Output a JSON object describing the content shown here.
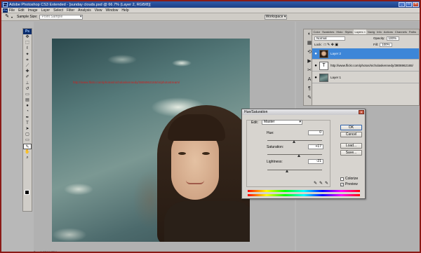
{
  "window": {
    "title": "Adobe Photoshop CS3 Extended - [sunday clouds.psd @ 66.7% (Layer 2, RGB/8)]",
    "app_badge": "Ps",
    "buttons": {
      "minimize": "_",
      "maximize": "□",
      "close": "×"
    }
  },
  "menu": [
    "File",
    "Edit",
    "Image",
    "Layer",
    "Select",
    "Filter",
    "Analysis",
    "View",
    "Window",
    "Help"
  ],
  "options_bar": {
    "tool_icon": "eyedropper-icon",
    "sample_size_label": "Sample Size:",
    "sample_size_value": "Point Sample",
    "workspace_label": "Workspace ▾"
  },
  "tools": {
    "badge": "Ps",
    "items": [
      "move",
      "marquee",
      "lasso",
      "quick-select",
      "crop",
      "slice",
      "heal",
      "brush",
      "stamp",
      "history-brush",
      "eraser",
      "gradient",
      "blur",
      "dodge",
      "pen",
      "type",
      "path-select",
      "shape",
      "notes",
      "eyedropper",
      "hand",
      "zoom"
    ]
  },
  "canvas": {
    "overlay_link": "http://www.flickr.com/photos/nicholaskennedy/3806962165/in/photostream/"
  },
  "status": {
    "text": "Doc: 1.66M/4.25M"
  },
  "layers_panel": {
    "tabs": [
      "Color",
      "Swatches",
      "Histo",
      "Styles",
      "Layers ×",
      "Navig",
      "Info",
      "Actions",
      "Channels",
      "Paths"
    ],
    "blend_mode": "Normal",
    "opacity_label": "Opacity:",
    "opacity_value": "100%",
    "lock_label": "Lock:",
    "fill_label": "Fill:",
    "fill_value": "100%",
    "layers": [
      {
        "name": "Layer 2",
        "selected": true
      },
      {
        "name": "http://www.flickr.com/photos/nicholaskennedy/3806962165/i",
        "selected": false
      },
      {
        "name": "Layer 1",
        "selected": false
      }
    ]
  },
  "hue_saturation": {
    "title": "Hue/Saturation",
    "close": "×",
    "edit_label": "Edit:",
    "edit_value": "Master",
    "hue_label": "Hue:",
    "hue_value": "0",
    "saturation_label": "Saturation:",
    "saturation_value": "+17",
    "lightness_label": "Lightness:",
    "lightness_value": "-21",
    "ok_label": "OK",
    "cancel_label": "Cancel",
    "load_label": "Load...",
    "save_label": "Save...",
    "colorize_label": "Colorize",
    "colorize_checked": false,
    "preview_label": "Preview",
    "preview_checked": true
  }
}
